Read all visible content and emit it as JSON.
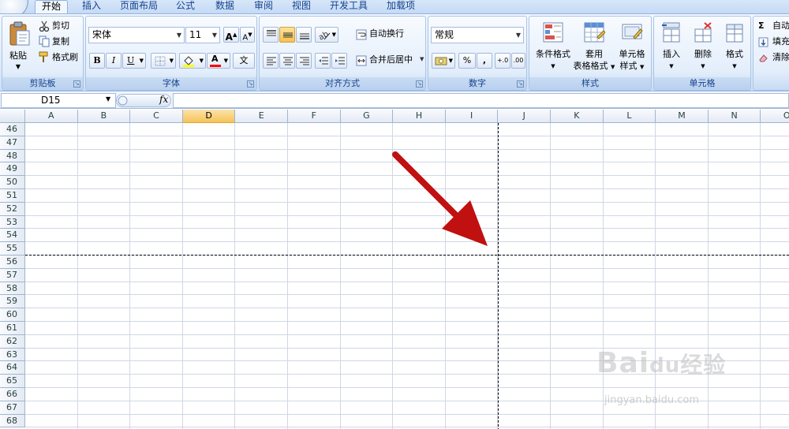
{
  "tabs": [
    "开始",
    "插入",
    "页面布局",
    "公式",
    "数据",
    "审阅",
    "视图",
    "开发工具",
    "加载项"
  ],
  "clipboard": {
    "paste": "粘贴",
    "cut": "剪切",
    "copy": "复制",
    "format_painter": "格式刷",
    "label": "剪贴板"
  },
  "font": {
    "name": "宋体",
    "size": "11",
    "bold": "B",
    "italic": "I",
    "underline": "U",
    "grow": "A",
    "shrink": "A",
    "phonetic": "文",
    "label": "字体",
    "fill_color": "#ffff00",
    "font_color": "#ff0000"
  },
  "alignment": {
    "wrap": "自动换行",
    "merge": "合并后居中",
    "label": "对齐方式"
  },
  "number": {
    "format": "常规",
    "percent": "%",
    "comma": ",",
    "increase_decimal": "+.0",
    "decrease_decimal": ".00",
    "label": "数字"
  },
  "styles": {
    "conditional": "条件格式",
    "table_1": "套用",
    "table_2": "表格格式",
    "cell_styles_1": "单元格",
    "cell_styles_2": "样式",
    "label": "样式"
  },
  "cells": {
    "insert": "插入",
    "delete": "删除",
    "format": "格式",
    "label": "单元格"
  },
  "editing": {
    "autosum": "自动",
    "fill": "填充",
    "clear": "清除",
    "sigma": "Σ"
  },
  "formula_bar": {
    "name_box": "D15",
    "fx": "fx"
  },
  "columns": [
    "A",
    "B",
    "C",
    "D",
    "E",
    "F",
    "G",
    "H",
    "I",
    "J",
    "K",
    "L",
    "M",
    "N",
    "O"
  ],
  "selected_column": "D",
  "rows": [
    "46",
    "47",
    "48",
    "49",
    "50",
    "51",
    "52",
    "53",
    "54",
    "55",
    "56",
    "57",
    "58",
    "59",
    "60",
    "61",
    "62",
    "63",
    "64",
    "65",
    "66",
    "67",
    "68"
  ],
  "annotation_color": "#c01010",
  "watermark": {
    "logo": "Bai",
    "logo_suffix": "du",
    "logo_cn": "经验",
    "url": "jingyan.baidu.com"
  }
}
